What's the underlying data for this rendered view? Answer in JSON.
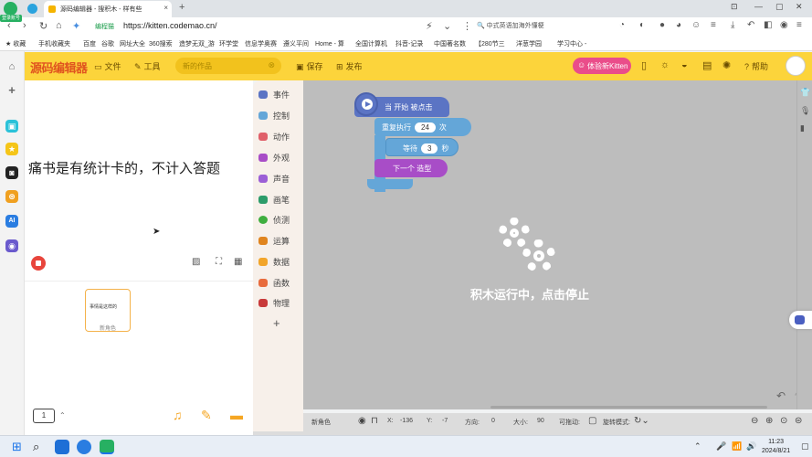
{
  "browser": {
    "tab_title": "源码编辑器 - 搜积木 - 样有些",
    "url_badge": "编程猫",
    "url": "https://kitten.codemao.cn/",
    "search_text": "中式英语加海外懂梗",
    "bookmarks": [
      "收藏",
      "手机收藏夹",
      "百度",
      "谷歌",
      "网址大全",
      "360搜索",
      "造梦无双_游",
      "环学堂",
      "信息学奥赛",
      "遵义平间",
      "Home - 算",
      "全国计算机",
      "抖音-记录",
      "中国著名数",
      "【280节三",
      "洋葱学园",
      "学习中心 -"
    ]
  },
  "os_sidebar": {
    "badge": "登录账号"
  },
  "app": {
    "brand": "源码编辑器",
    "menu_file": "文件",
    "menu_tools": "工具",
    "works_placeholder": "新的作品",
    "save": "保存",
    "publish": "发布",
    "try_new": "体验新Kitten",
    "help": "帮助"
  },
  "stage": {
    "text": "痛书是有统计卡的，不计入答题"
  },
  "sprite": {
    "thumb_text": "事情是这样的",
    "name": "新角色"
  },
  "pager": {
    "page": "1"
  },
  "categories": [
    {
      "label": "事件",
      "color": "#5b74c4"
    },
    {
      "label": "控制",
      "color": "#64a6d8"
    },
    {
      "label": "动作",
      "color": "#e0606a"
    },
    {
      "label": "外观",
      "color": "#a84dc7"
    },
    {
      "label": "声音",
      "color": "#9b5fd6"
    },
    {
      "label": "画笔",
      "color": "#2c9c6a"
    },
    {
      "label": "侦测",
      "color": "#3fae3f"
    },
    {
      "label": "运算",
      "color": "#e0841e"
    },
    {
      "label": "数据",
      "color": "#f2a52a"
    },
    {
      "label": "函数",
      "color": "#e86c3d"
    },
    {
      "label": "物理",
      "color": "#c83a3a"
    }
  ],
  "script": {
    "event_label": "当 开始 被点击",
    "repeat_label": "重复执行",
    "repeat_count": "24",
    "repeat_unit": "次",
    "wait_label": "等待",
    "wait_value": "3",
    "wait_unit": "秒",
    "next_label": "下一个 造型",
    "running_text": "积木运行中，点击停止"
  },
  "status": {
    "sprite_name": "新角色",
    "x_label": "X:",
    "x_value": "-136",
    "y_label": "Y:",
    "y_value": "-7",
    "direction_label": "方向:",
    "direction_value": "0",
    "size_label": "大小:",
    "size_value": "90",
    "draggable_label": "可拖动:",
    "rotation_label": "旋转模式:"
  },
  "taskbar": {
    "time": "11:23",
    "date": "2024/8/21"
  }
}
